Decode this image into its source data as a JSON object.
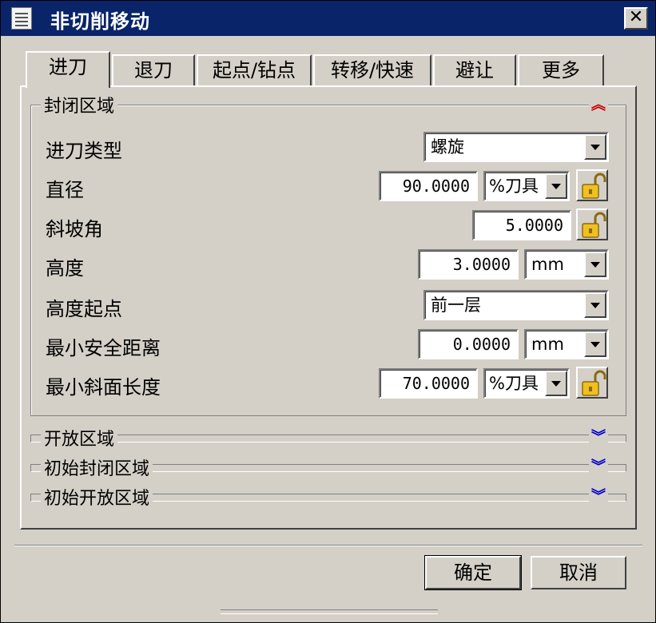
{
  "window": {
    "title": "非切削移动",
    "close_label": "✕"
  },
  "tabs": [
    {
      "label": "进刀",
      "active": true
    },
    {
      "label": "退刀",
      "active": false
    },
    {
      "label": "起点/钻点",
      "active": false
    },
    {
      "label": "转移/快速",
      "active": false
    },
    {
      "label": "避让",
      "active": false
    },
    {
      "label": "更多",
      "active": false
    }
  ],
  "closed_area": {
    "title": "封闭区域",
    "fields": {
      "entry_type": {
        "label": "进刀类型",
        "value": "螺旋"
      },
      "diameter": {
        "label": "直径",
        "value": "90.0000",
        "unit": "%刀具"
      },
      "ramp_angle": {
        "label": "斜坡角",
        "value": "5.0000"
      },
      "height": {
        "label": "高度",
        "value": "3.0000",
        "unit": "mm"
      },
      "height_from": {
        "label": "高度起点",
        "value": "前一层"
      },
      "min_safe_distance": {
        "label": "最小安全距离",
        "value": "0.0000",
        "unit": "mm"
      },
      "min_ramp_length": {
        "label": "最小斜面长度",
        "value": "70.0000",
        "unit": "%刀具"
      }
    }
  },
  "collapsed_sections": [
    {
      "title": "开放区域"
    },
    {
      "title": "初始封闭区域"
    },
    {
      "title": "初始开放区域"
    }
  ],
  "buttons": {
    "ok": "确定",
    "cancel": "取消"
  },
  "colors": {
    "titlebar": "#0a246a",
    "face": "#d4d0c8",
    "expand_chevron": "#cc0000",
    "collapse_chevron": "#0000cc"
  }
}
